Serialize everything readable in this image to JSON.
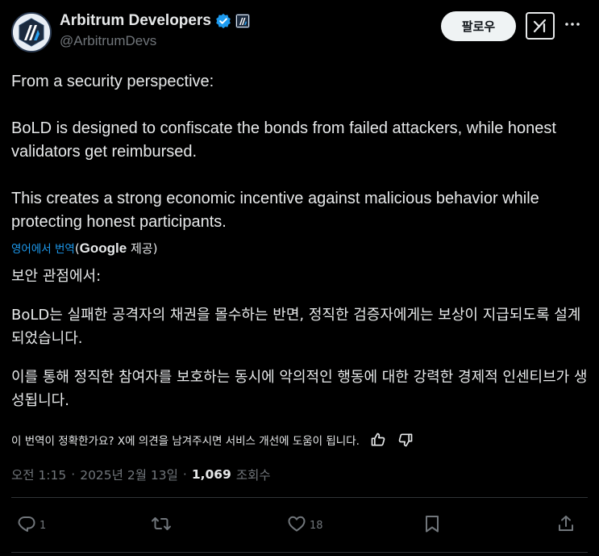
{
  "author": {
    "display_name": "Arbitrum Developers",
    "handle": "@ArbitrumDevs",
    "avatar_icon": "arbitrum-logo-icon",
    "verified_icon": "verified-badge-icon",
    "affiliate_icon": "arbitrum-affiliate-badge-icon"
  },
  "header": {
    "follow_label": "팔로우",
    "grok_icon": "grok-icon",
    "more_icon": "more-icon"
  },
  "tweet": {
    "paragraphs": [
      "From a security perspective:",
      "BoLD is designed to confiscate the bonds from failed attackers, while honest validators get reimbursed.",
      "This creates a strong economic incentive against malicious behavior while protecting honest participants."
    ]
  },
  "translation": {
    "link_label": "영어에서 번역",
    "provider_prefix": "(",
    "provider_name": "Google",
    "provider_suffix": " 제공)",
    "paragraphs": [
      "보안 관점에서:",
      "BoLD는 실패한 공격자의 채권을 몰수하는 반면, 정직한 검증자에게는 보상이 지급되도록 설계되었습니다.",
      "이를 통해 정직한 참여자를 보호하는 동시에 악의적인 행동에 대한 강력한 경제적 인센티브가 생성됩니다."
    ],
    "feedback_text": "이 번역이 정확한가요? X에 의견을 남겨주시면 서비스 개선에 도움이 됩니다.",
    "thumbs_up_icon": "thumbs-up-icon",
    "thumbs_down_icon": "thumbs-down-icon"
  },
  "meta": {
    "time": "오전 1:15",
    "separator": "·",
    "date": "2025년 2월 13일",
    "views_count": "1,069",
    "views_label": "조회수"
  },
  "actions": {
    "reply_count": "1",
    "repost_count": "",
    "like_count": "18",
    "reply_icon": "reply-icon",
    "repost_icon": "repost-icon",
    "like_icon": "heart-icon",
    "bookmark_icon": "bookmark-icon",
    "share_icon": "share-icon"
  },
  "colors": {
    "background": "#000000",
    "text": "#e7e9ea",
    "muted": "#71767b",
    "link": "#1d9bf0",
    "verified": "#1d9bf0",
    "divider": "#2f3336"
  }
}
